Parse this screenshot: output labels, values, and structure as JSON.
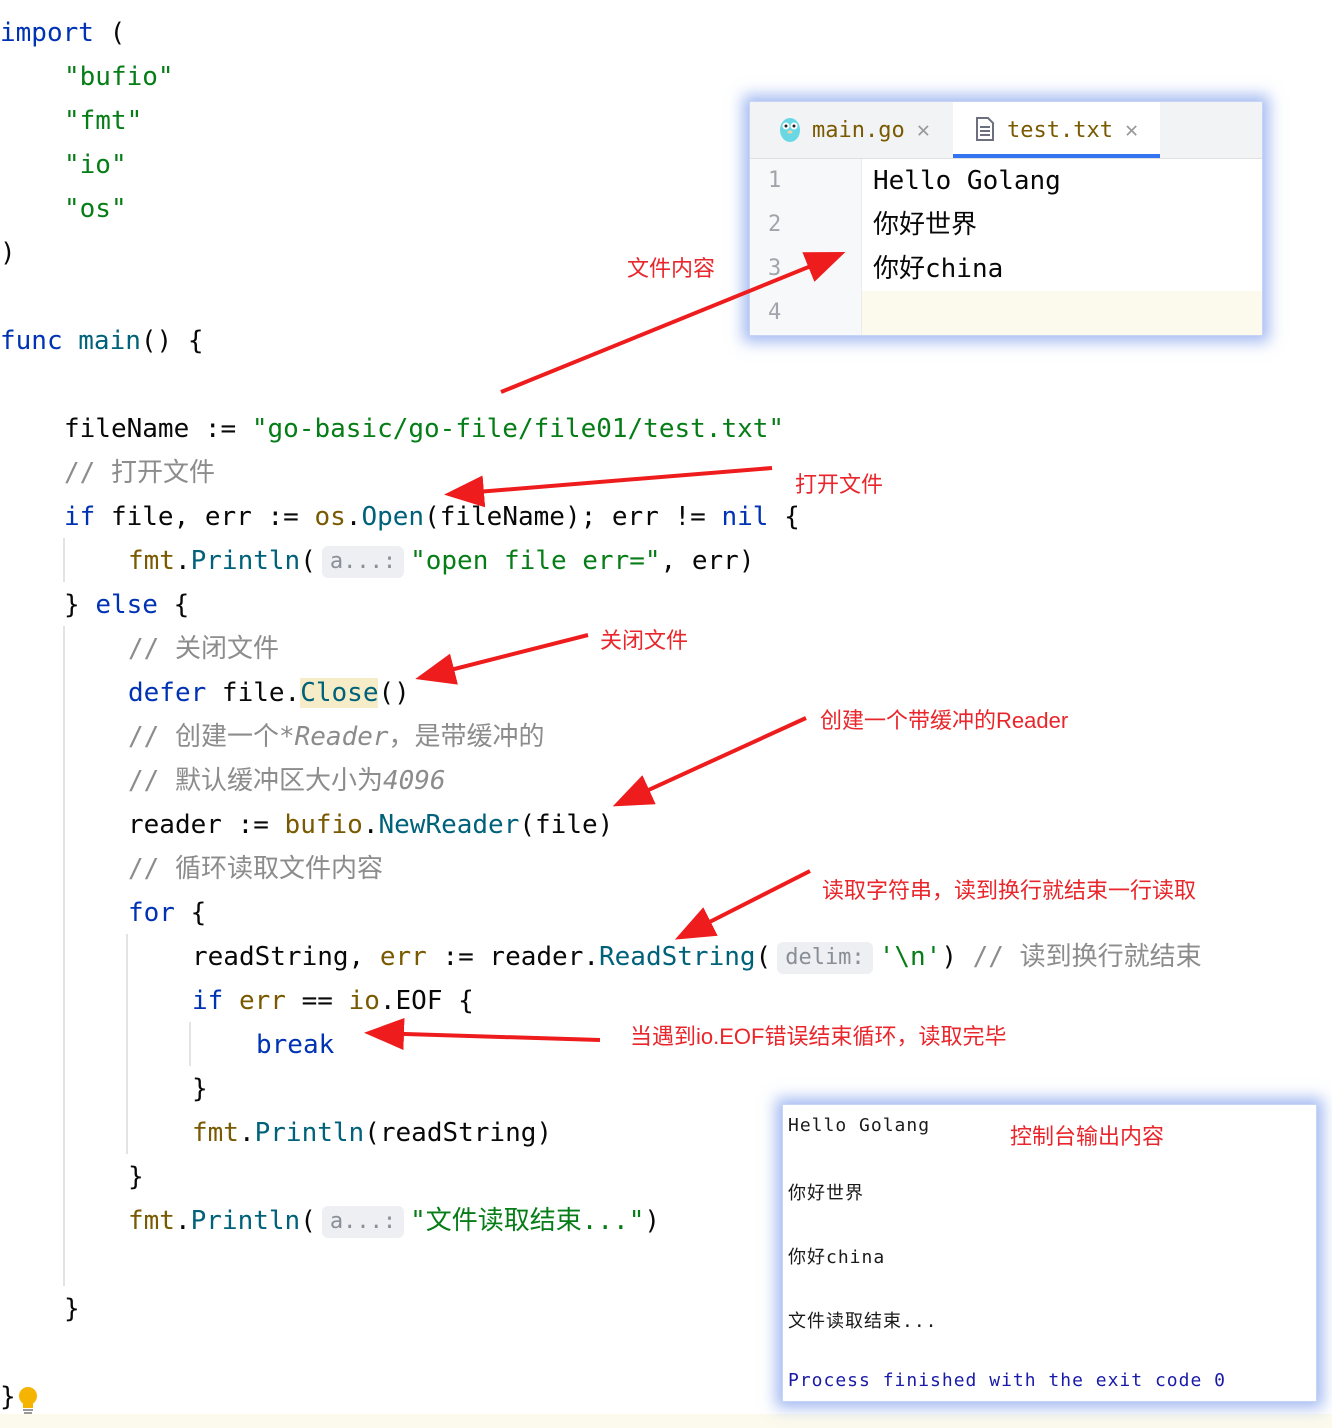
{
  "code_lines": {
    "l1": [
      "import",
      " ("
    ],
    "l2": "\"bufio\"",
    "l3": "\"fmt\"",
    "l4": "\"io\"",
    "l5": "\"os\"",
    "l6": ")",
    "l7": [
      "func",
      " ",
      "main",
      "() {"
    ],
    "l8": [
      "fileName := ",
      "\"go-basic/go-file/file01/test.txt\""
    ],
    "l9": "// 打开文件",
    "l10": [
      "if",
      " file, err := ",
      "os",
      ".",
      "Open",
      "(fileName); err != ",
      "nil",
      " {"
    ],
    "l11": [
      "fmt",
      ".",
      "Println",
      "(",
      "a...:",
      "\"open file err=\"",
      ", err)"
    ],
    "l12": [
      "} ",
      "else",
      " {"
    ],
    "l13": "// 关闭文件",
    "l14": [
      "defer",
      " file.",
      "Close",
      "()"
    ],
    "l15": [
      "// 创建一个",
      "*Reader",
      "，是带缓冲的"
    ],
    "l16": [
      "// 默认缓冲区大小为",
      "4096"
    ],
    "l17": [
      "reader := ",
      "bufio",
      ".",
      "NewReader",
      "(file)"
    ],
    "l18": "// 循环读取文件内容",
    "l19": [
      "for",
      " {"
    ],
    "l20": [
      "readString, ",
      "err",
      " := reader.",
      "ReadString",
      "(",
      "delim:",
      "'\\n'",
      ") ",
      "// 读到换行就结束"
    ],
    "l21": [
      "if",
      " ",
      "err",
      " == ",
      "io",
      ".EOF {"
    ],
    "l22": "break",
    "l23": "}",
    "l24": [
      "fmt",
      ".",
      "Println",
      "(readString)"
    ],
    "l25": "}",
    "l26": [
      "fmt",
      ".",
      "Println",
      "(",
      "a...:",
      "\"文件读取结束...\"",
      ")"
    ],
    "l27": "}",
    "l28": "}"
  },
  "editor_window": {
    "tabs": [
      {
        "label": "main.go",
        "icon": "gopher-icon"
      },
      {
        "label": "test.txt",
        "icon": "text-file-icon",
        "active": true
      }
    ],
    "line_numbers": [
      "1",
      "2",
      "3",
      "4"
    ],
    "lines": [
      "Hello Golang",
      "你好世界",
      "你好china",
      ""
    ]
  },
  "console": {
    "lines": [
      "Hello Golang",
      "你好世界",
      "你好china",
      "文件读取结束...",
      "Process finished with the exit code 0"
    ]
  },
  "annotations": {
    "file_content": "文件内容",
    "open_file": "打开文件",
    "close_file": "关闭文件",
    "create_reader": "创建一个带缓冲的Reader",
    "read_string": "读取字符串，读到换行就结束一行读取",
    "eof": "当遇到io.EOF错误结束循环，读取完毕",
    "console_output": "控制台输出内容"
  },
  "colors": {
    "keyword": "#0033b3",
    "string": "#067d17",
    "package": "#7a5a00",
    "function": "#00627a",
    "comment": "#8c8c8c",
    "annotation_red": "#e8262b",
    "window_glow": "#5a82e6"
  }
}
